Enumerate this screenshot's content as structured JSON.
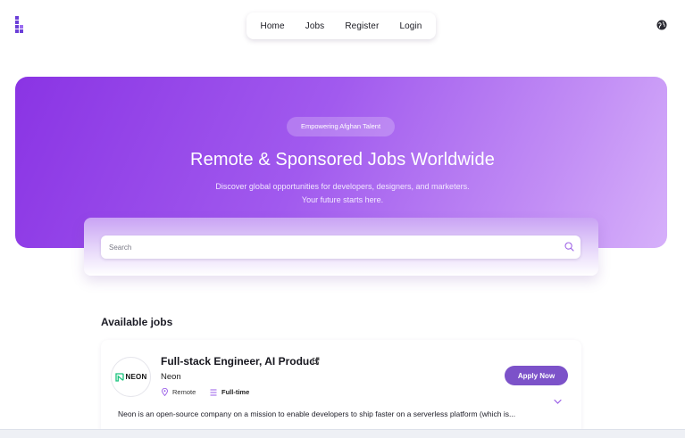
{
  "header": {
    "nav": [
      "Home",
      "Jobs",
      "Register",
      "Login"
    ],
    "logo_icon": "brand-logo-icon",
    "globe_icon": "globe-icon"
  },
  "hero": {
    "badge": "Empowering Afghan Talent",
    "title": "Remote & Sponsored Jobs Worldwide",
    "subtitle_line1": "Discover global opportunities for developers, designers, and marketers.",
    "subtitle_line2": "Your future starts here."
  },
  "search": {
    "placeholder": "Search",
    "value": "",
    "icon": "search-icon"
  },
  "jobs": {
    "section_title": "Available jobs",
    "items": [
      {
        "title": "Full-stack Engineer, AI Product",
        "company": "Neon",
        "company_logo_text": "NEON",
        "location": "Remote",
        "type": "Full-time",
        "apply_label": "Apply Now",
        "description": "Neon is an open-source company on a mission to enable developers to ship faster on a serverless platform (which is..."
      }
    ]
  },
  "colors": {
    "accent": "#7c52c9",
    "hero_start": "#8a34e4",
    "hero_end": "#d6b0fa",
    "neon_green": "#19c37d"
  }
}
